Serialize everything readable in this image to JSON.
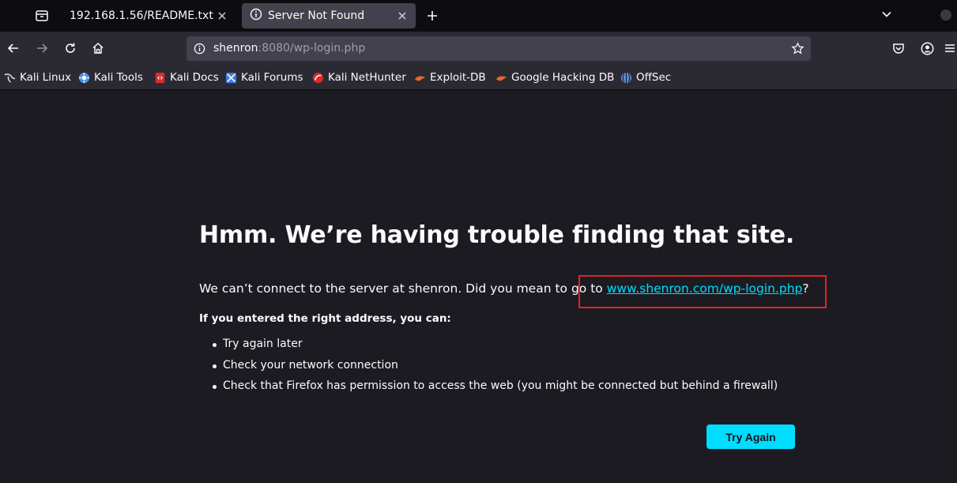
{
  "tabs": [
    {
      "label": "192.168.1.56/README.txt",
      "active": false
    },
    {
      "label": "Server Not Found",
      "active": true
    }
  ],
  "navbar": {
    "url_host": "shenron",
    "url_rest": ":8080/wp-login.php"
  },
  "bookmarks": [
    {
      "label": "Kali Linux",
      "icon": "kali-dragon-icon",
      "color": "#e0e0e0"
    },
    {
      "label": "Kali Tools",
      "icon": "kali-tools-icon",
      "color": "#4a8fe7"
    },
    {
      "label": "Kali Docs",
      "icon": "kali-docs-icon",
      "color": "#d62d2d"
    },
    {
      "label": "Kali Forums",
      "icon": "kali-forums-icon",
      "color": "#3b7de0"
    },
    {
      "label": "Kali NetHunter",
      "icon": "nethunter-icon",
      "color": "#d62d2d"
    },
    {
      "label": "Exploit-DB",
      "icon": "exploit-db-icon",
      "color": "#e8662a"
    },
    {
      "label": "Google Hacking DB",
      "icon": "ghdb-icon",
      "color": "#e8662a"
    },
    {
      "label": "OffSec",
      "icon": "offsec-icon",
      "color": "#5b8dd9"
    }
  ],
  "error": {
    "title": "Hmm. We’re having trouble finding that site.",
    "desc_prefix": "We can’t connect to the server at shenron. Did you mean to go to ",
    "suggested_link": "www.shenron.com/wp-login.php",
    "desc_suffix": "?",
    "subhead": "If you entered the right address, you can:",
    "suggestions": [
      "Try again later",
      "Check your network connection",
      "Check that Firefox has permission to access the web (you might be connected but behind a firewall)"
    ],
    "button_label": "Try Again"
  },
  "colors": {
    "accent": "#00ddff",
    "highlight_box": "#e22229",
    "page_bg": "#1c1b22"
  }
}
